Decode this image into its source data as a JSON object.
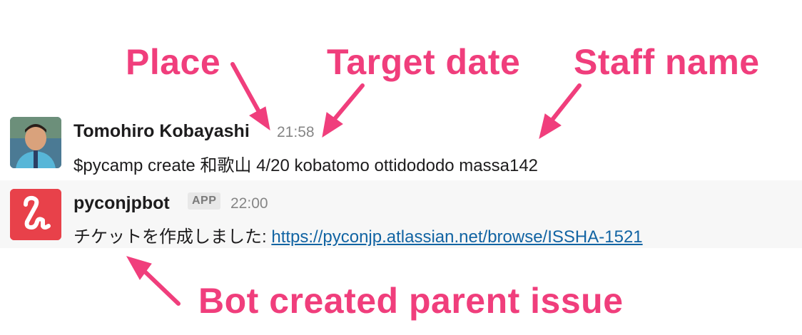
{
  "annotations": {
    "place": "Place",
    "target_date": "Target date",
    "staff_name": "Staff name",
    "bot_created": "Bot created parent issue"
  },
  "messages": [
    {
      "author": "Tomohiro Kobayashi",
      "time": "21:58",
      "text": "$pycamp create 和歌山 4/20 kobatomo ottidododo massa142",
      "avatar": "user-photo-avatar"
    },
    {
      "author": "pyconjpbot",
      "badge": "APP",
      "time": "22:00",
      "text_prefix": "チケットを作成しました: ",
      "link": "https://pyconjp.atlassian.net/browse/ISSHA-1521",
      "avatar": "bot-logo-avatar"
    }
  ],
  "colors": {
    "annotation": "#f03e7c",
    "bot_avatar_bg": "#e8414a",
    "link": "#1264a3",
    "bot_row_bg": "#f7f7f7"
  }
}
